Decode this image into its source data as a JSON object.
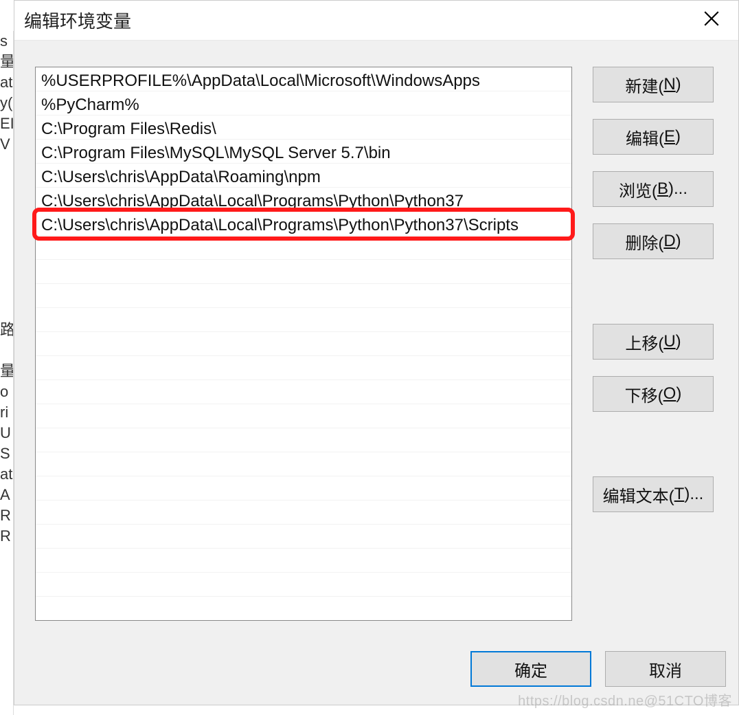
{
  "dialog": {
    "title": "编辑环境变量"
  },
  "list": {
    "items": [
      "%USERPROFILE%\\AppData\\Local\\Microsoft\\WindowsApps",
      "%PyCharm%",
      "C:\\Program Files\\Redis\\",
      "C:\\Program Files\\MySQL\\MySQL Server 5.7\\bin",
      "C:\\Users\\chris\\AppData\\Roaming\\npm",
      "C:\\Users\\chris\\AppData\\Local\\Programs\\Python\\Python37",
      "C:\\Users\\chris\\AppData\\Local\\Programs\\Python\\Python37\\Scripts"
    ],
    "highlighted_index": 6
  },
  "buttons": {
    "new": {
      "text": "新建(",
      "mnemonic": "N",
      "suffix": ")"
    },
    "edit": {
      "text": "编辑(",
      "mnemonic": "E",
      "suffix": ")"
    },
    "browse": {
      "text": "浏览(",
      "mnemonic": "B",
      "suffix": ")..."
    },
    "delete": {
      "text": "删除(",
      "mnemonic": "D",
      "suffix": ")"
    },
    "up": {
      "text": "上移(",
      "mnemonic": "U",
      "suffix": ")"
    },
    "down": {
      "text": "下移(",
      "mnemonic": "O",
      "suffix": ")"
    },
    "editText": {
      "text": "编辑文本(",
      "mnemonic": "T",
      "suffix": ")..."
    },
    "ok": "确定",
    "cancel": "取消"
  },
  "watermark": "https://blog.csdn.ne@51CTO博客",
  "bg_left": "s\n量\nat\ny(\nEI\nV\n\n\n\n\n\n\n\n\n路\n\n量\no\nri\nU\nS\nat\nA\nR\nR"
}
